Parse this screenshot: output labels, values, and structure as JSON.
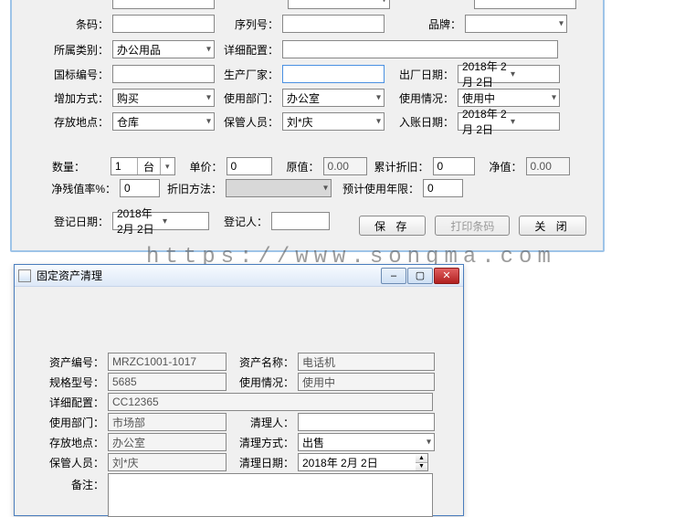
{
  "panel1": {
    "barcode_label": "条码：",
    "seq_label": "序列号：",
    "brand_label": "品牌：",
    "category_label": "所属类别：",
    "category_value": "办公用品",
    "detail_label": "详细配置：",
    "national_code_label": "国标编号：",
    "manufacturer_label": "生产厂家：",
    "factory_date_label": "出厂日期：",
    "factory_date_value": "2018年 2月 2日",
    "add_method_label": "增加方式：",
    "add_method_value": "购买",
    "dept_label": "使用部门：",
    "dept_value": "办公室",
    "status_label": "使用情况：",
    "status_value": "使用中",
    "location_label": "存放地点：",
    "location_value": "仓库",
    "custodian_label": "保管人员：",
    "custodian_value": "刘*庆",
    "book_date_label": "入账日期：",
    "book_date_value": "2018年 2月 2日",
    "qty_label": "数量：",
    "qty_value": "1",
    "qty_unit": "台",
    "price_label": "单价：",
    "price_value": "0",
    "orig_label": "原值：",
    "orig_value": "0.00",
    "depr_sum_label": "累计折旧：",
    "depr_sum_value": "0",
    "net_label": "净值：",
    "net_value": "0.00",
    "residual_label": "净残值率%：",
    "residual_value": "0",
    "depr_method_label": "折旧方法：",
    "est_years_label": "预计使用年限：",
    "est_years_value": "0",
    "reg_date_label": "登记日期：",
    "reg_date_value": "2018年 2月 2日",
    "registrar_label": "登记人：",
    "btn_save": "保 存",
    "btn_print": "打印条码",
    "btn_close": "关 闭"
  },
  "window2": {
    "title": "固定资产清理",
    "asset_no_label": "资产编号：",
    "asset_no_value": "MRZC1001-1017",
    "asset_name_label": "资产名称：",
    "asset_name_value": "电话机",
    "spec_label": "规格型号：",
    "spec_value": "5685",
    "status_label": "使用情况：",
    "status_value": "使用中",
    "detail_label": "详细配置：",
    "detail_value": "CC12365",
    "dept_label": "使用部门：",
    "dept_value": "市场部",
    "handler_label": "清理人：",
    "location_label": "存放地点：",
    "location_value": "办公室",
    "dispose_method_label": "清理方式：",
    "dispose_method_value": "出售",
    "custodian_label": "保管人员：",
    "custodian_value": "刘*庆",
    "dispose_date_label": "清理日期：",
    "dispose_date_value": "2018年 2月 2日",
    "remark_label": "备注："
  },
  "watermark": "https://www.songma.com"
}
